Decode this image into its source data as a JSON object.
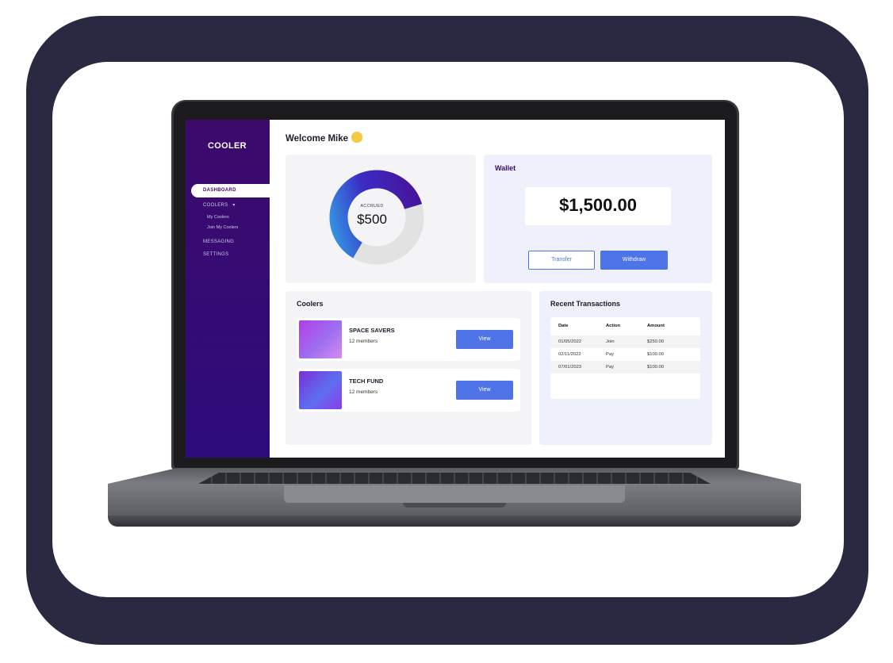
{
  "app": {
    "logo": "COOLER"
  },
  "sidebar": {
    "items": [
      {
        "label": "DASHBOARD",
        "active": true
      },
      {
        "label": "COOLERS",
        "has_dropdown": true
      },
      {
        "label": "My Coolers"
      },
      {
        "label": "Join My Coolers"
      },
      {
        "label": "MESSAGING"
      },
      {
        "label": "SETTINGS"
      }
    ]
  },
  "header": {
    "welcome": "Welcome Mike",
    "welcome_icon": "waving-hand-icon"
  },
  "accrued": {
    "label": "ACCRUED",
    "value": "$500",
    "ring_fill_fraction": 0.62
  },
  "wallet": {
    "title": "Wallet",
    "balance": "$1,500.00",
    "transfer_label": "Transfer",
    "withdraw_label": "Withdraw"
  },
  "coolers": {
    "title": "Coolers",
    "items": [
      {
        "name": "SPACE SAVERS",
        "members": "12 members",
        "view_label": "View"
      },
      {
        "name": "TECH FUND",
        "members": "12 members",
        "view_label": "View"
      }
    ]
  },
  "transactions": {
    "title": "Recent Transactions",
    "columns": [
      "Date",
      "Action",
      "Amount"
    ],
    "rows": [
      [
        "01/05/2022",
        "Join",
        "$250.00"
      ],
      [
        "02/11/2022",
        "Pay",
        "$100.00"
      ],
      [
        "07/01/2023",
        "Pay",
        "$100.00"
      ]
    ]
  },
  "colors": {
    "frame": "#2a2942",
    "sidebar": "#3d0a6b",
    "accent": "#4f74e8",
    "donut_start": "#4a1094",
    "donut_end": "#33a5e8",
    "donut_track": "#e2e2e2"
  }
}
